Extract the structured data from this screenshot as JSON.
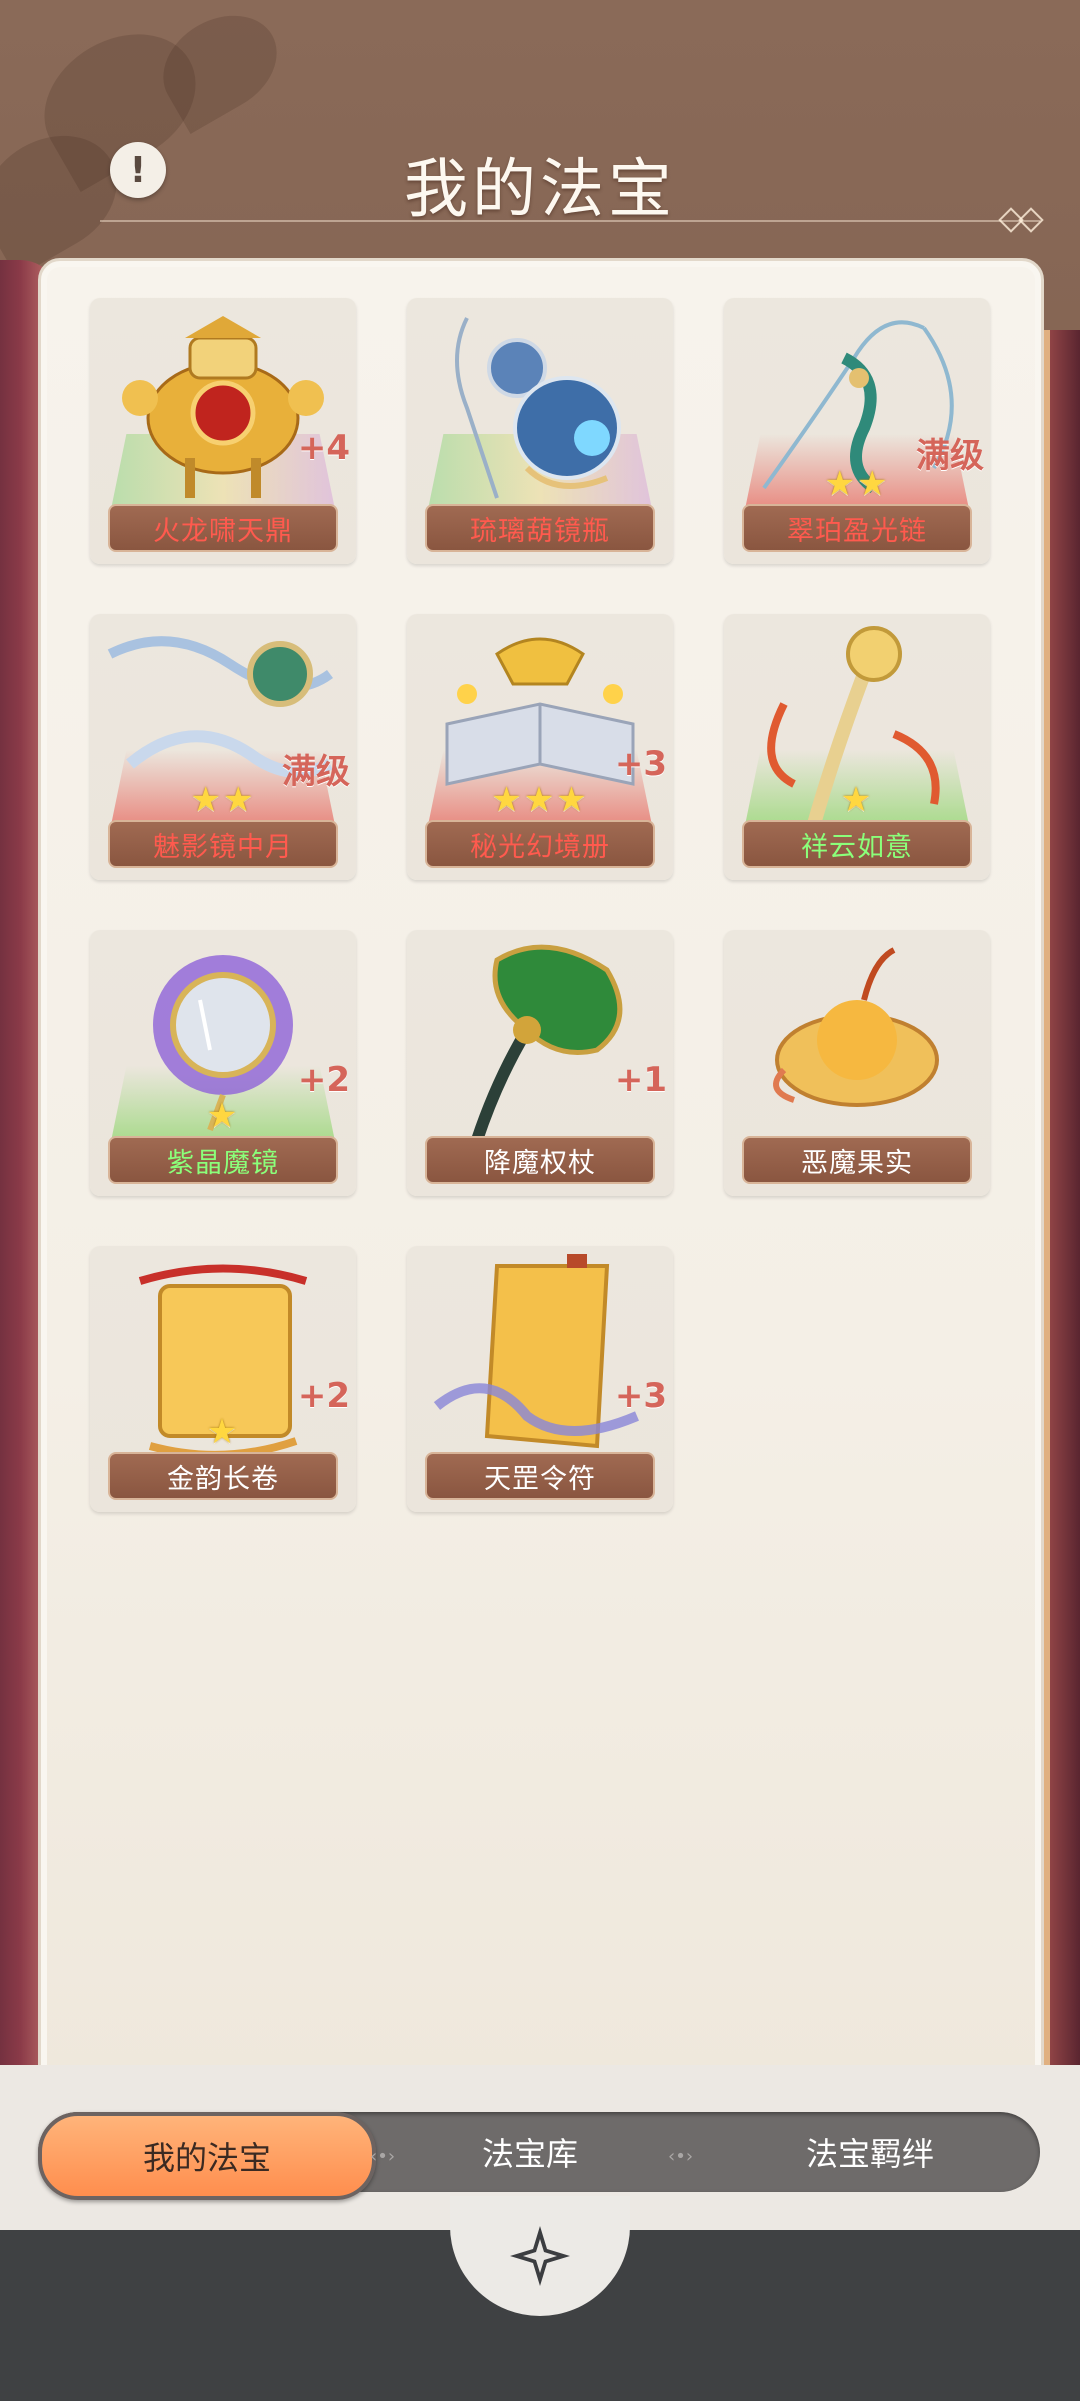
{
  "header": {
    "title": "我的法宝",
    "info_symbol": "!"
  },
  "items": [
    {
      "name": "火龙啸天鼎",
      "level": "+4",
      "stars": "",
      "glow": "rainbow",
      "name_style": "red-text"
    },
    {
      "name": "琉璃葫镜瓶",
      "level": "",
      "stars": "",
      "glow": "rainbow",
      "name_style": "red-text"
    },
    {
      "name": "翠珀盈光链",
      "level": "满级",
      "stars": "★★",
      "glow": "red",
      "name_style": "red-text"
    },
    {
      "name": "魅影镜中月",
      "level": "满级",
      "stars": "★★",
      "glow": "red",
      "name_style": "red-text"
    },
    {
      "name": "秘光幻境册",
      "level": "+3",
      "stars": "★★★",
      "glow": "red",
      "name_style": "red-text"
    },
    {
      "name": "祥云如意",
      "level": "",
      "stars": "★",
      "glow": "green",
      "name_style": "green-text"
    },
    {
      "name": "紫晶魔镜",
      "level": "+2",
      "stars": "★",
      "glow": "green",
      "name_style": "green-text"
    },
    {
      "name": "降魔权杖",
      "level": "+1",
      "stars": "",
      "glow": "",
      "name_style": ""
    },
    {
      "name": "恶魔果实",
      "level": "",
      "stars": "",
      "glow": "",
      "name_style": ""
    },
    {
      "name": "金韵长卷",
      "level": "+2",
      "stars": "★",
      "glow": "",
      "name_style": ""
    },
    {
      "name": "天罡令符",
      "level": "+3",
      "stars": "",
      "glow": "",
      "name_style": ""
    }
  ],
  "tabs": [
    {
      "label": "我的法宝",
      "active": true
    },
    {
      "label": "法宝库",
      "active": false
    },
    {
      "label": "法宝羁绊",
      "active": false
    }
  ],
  "colors": {
    "accent": "#ff8e4e",
    "panel": "#f4efe6",
    "level_text": "#d5655a",
    "bottom_bar": "#3f4143"
  }
}
